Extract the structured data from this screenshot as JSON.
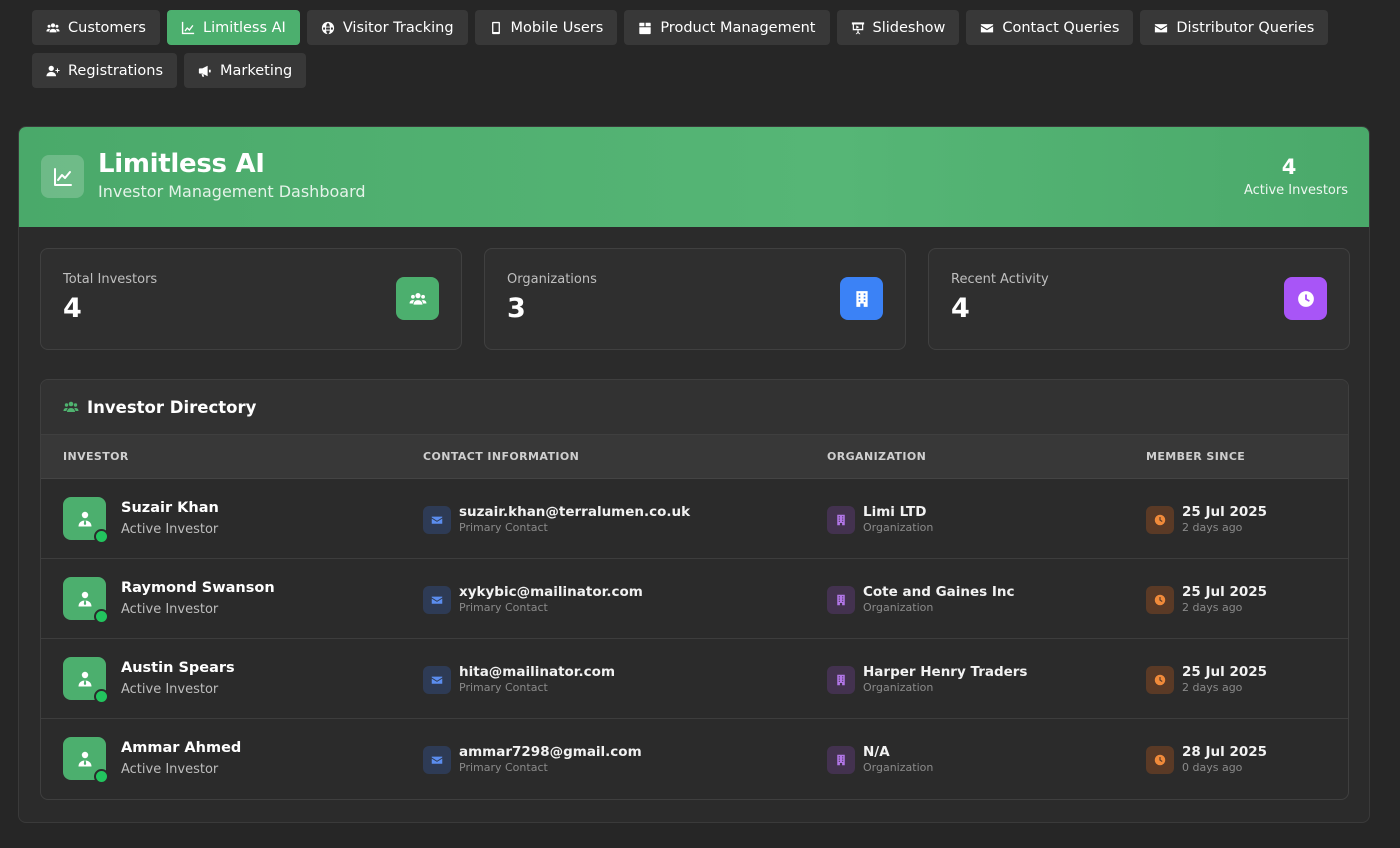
{
  "nav": [
    {
      "label": "Customers",
      "icon": "users-icon",
      "active": false
    },
    {
      "label": "Limitless AI",
      "icon": "chart-line-icon",
      "active": true
    },
    {
      "label": "Visitor Tracking",
      "icon": "globe-icon",
      "active": false
    },
    {
      "label": "Mobile Users",
      "icon": "mobile-icon",
      "active": false
    },
    {
      "label": "Product Management",
      "icon": "box-icon",
      "active": false
    },
    {
      "label": "Slideshow",
      "icon": "slides-icon",
      "active": false
    },
    {
      "label": "Contact Queries",
      "icon": "envelope-icon",
      "active": false
    },
    {
      "label": "Distributor Queries",
      "icon": "envelope-icon",
      "active": false
    },
    {
      "label": "Registrations",
      "icon": "user-plus-icon",
      "active": false
    },
    {
      "label": "Marketing",
      "icon": "megaphone-icon",
      "active": false
    }
  ],
  "header": {
    "title": "Limitless AI",
    "subtitle": "Investor Management Dashboard",
    "active_count": "4",
    "active_label": "Active Investors",
    "accent_color": "#4caf6e"
  },
  "stats": [
    {
      "label": "Total Investors",
      "value": "4",
      "icon": "users-icon",
      "color": "#4caf6e"
    },
    {
      "label": "Organizations",
      "value": "3",
      "icon": "building-icon",
      "color": "#3b82f6"
    },
    {
      "label": "Recent Activity",
      "value": "4",
      "icon": "clock-icon",
      "color": "#a855f7"
    }
  ],
  "directory": {
    "title": "Investor Directory",
    "columns": [
      "INVESTOR",
      "CONTACT INFORMATION",
      "ORGANIZATION",
      "MEMBER SINCE"
    ],
    "rows": [
      {
        "name": "Suzair Khan",
        "role": "Active Investor",
        "email": "suzair.khan@terralumen.co.uk",
        "email_note": "Primary Contact",
        "org": "Limi LTD",
        "org_note": "Organization",
        "date": "25 Jul 2025",
        "ago": "2 days ago"
      },
      {
        "name": "Raymond Swanson",
        "role": "Active Investor",
        "email": "xykybic@mailinator.com",
        "email_note": "Primary Contact",
        "org": "Cote and Gaines Inc",
        "org_note": "Organization",
        "date": "25 Jul 2025",
        "ago": "2 days ago"
      },
      {
        "name": "Austin Spears",
        "role": "Active Investor",
        "email": "hita@mailinator.com",
        "email_note": "Primary Contact",
        "org": "Harper Henry Traders",
        "org_note": "Organization",
        "date": "25 Jul 2025",
        "ago": "2 days ago"
      },
      {
        "name": "Ammar Ahmed",
        "role": "Active Investor",
        "email": "ammar7298@gmail.com",
        "email_note": "Primary Contact",
        "org": "N/A",
        "org_note": "Organization",
        "date": "28 Jul 2025",
        "ago": "0 days ago"
      }
    ]
  }
}
